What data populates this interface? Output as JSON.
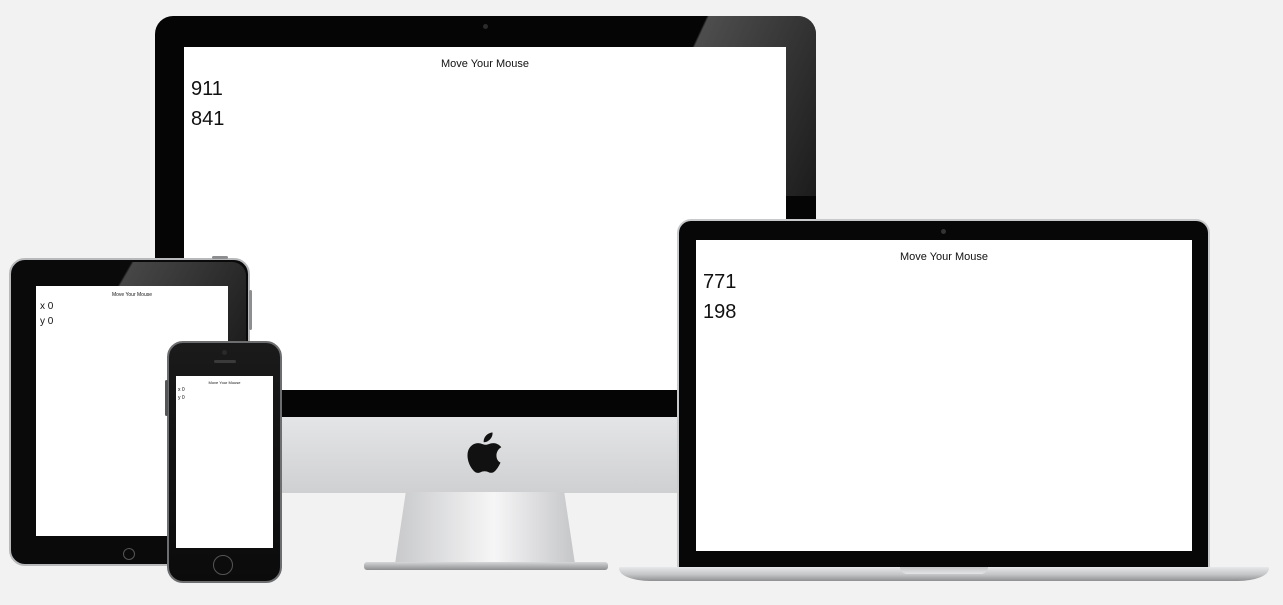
{
  "imac": {
    "title": "Move Your Mouse",
    "x_value": "911",
    "y_value": "841"
  },
  "macbook": {
    "title": "Move Your Mouse",
    "x_value": "771",
    "y_value": "198"
  },
  "ipad": {
    "title": "Move Your Mouse",
    "x_text": "x 0",
    "y_text": "y 0"
  },
  "iphone": {
    "title": "Move Your Mouse",
    "x_text": "x 0",
    "y_text": "y 0"
  },
  "colors": {
    "background": "#f2f2f2",
    "bezel": "#050505",
    "screen": "#ffffff",
    "aluminum": "#d4d5d7"
  },
  "icons": {
    "imac_logo": "apple-logo-icon"
  }
}
